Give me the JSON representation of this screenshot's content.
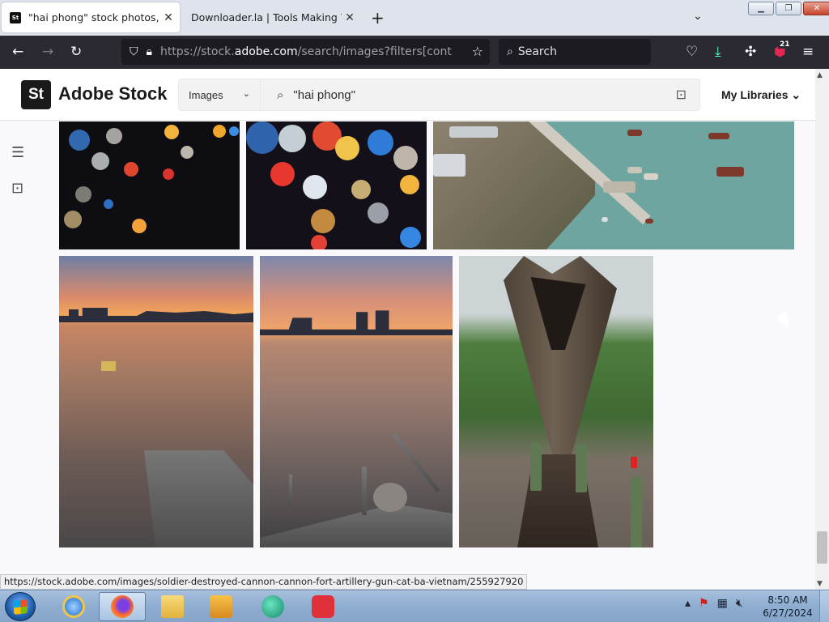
{
  "browser": {
    "tabs": [
      {
        "favicon": "St",
        "title": "\"hai phong\" stock photos, royalty-free",
        "active": true
      },
      {
        "title": "Downloader.la | Tools Making Your Life",
        "active": false
      }
    ],
    "url": {
      "prefix": "https://stock.",
      "domain": "adobe.com",
      "rest": "/search/images?filters[content_type"
    },
    "search_placeholder": "Search",
    "extension_badge": "21"
  },
  "site": {
    "logo_mark": "St",
    "logo_text": "Adobe Stock",
    "content_type": "Images",
    "query": "\"hai phong\"",
    "my_libraries": "My Libraries"
  },
  "status_url": "https://stock.adobe.com/images/soldier-destroyed-cannon-cannon-fort-artillery-gun-cat-ba-vietnam/255927920",
  "taskbar": {
    "time": "8:50 AM",
    "date": "6/27/2024"
  },
  "colors": {
    "browser_toolbar": "#2b2a33",
    "tab_strip": "#dfe3ec",
    "page_bg": "#f9f9fb",
    "logo_bg": "#1a1a1a"
  }
}
